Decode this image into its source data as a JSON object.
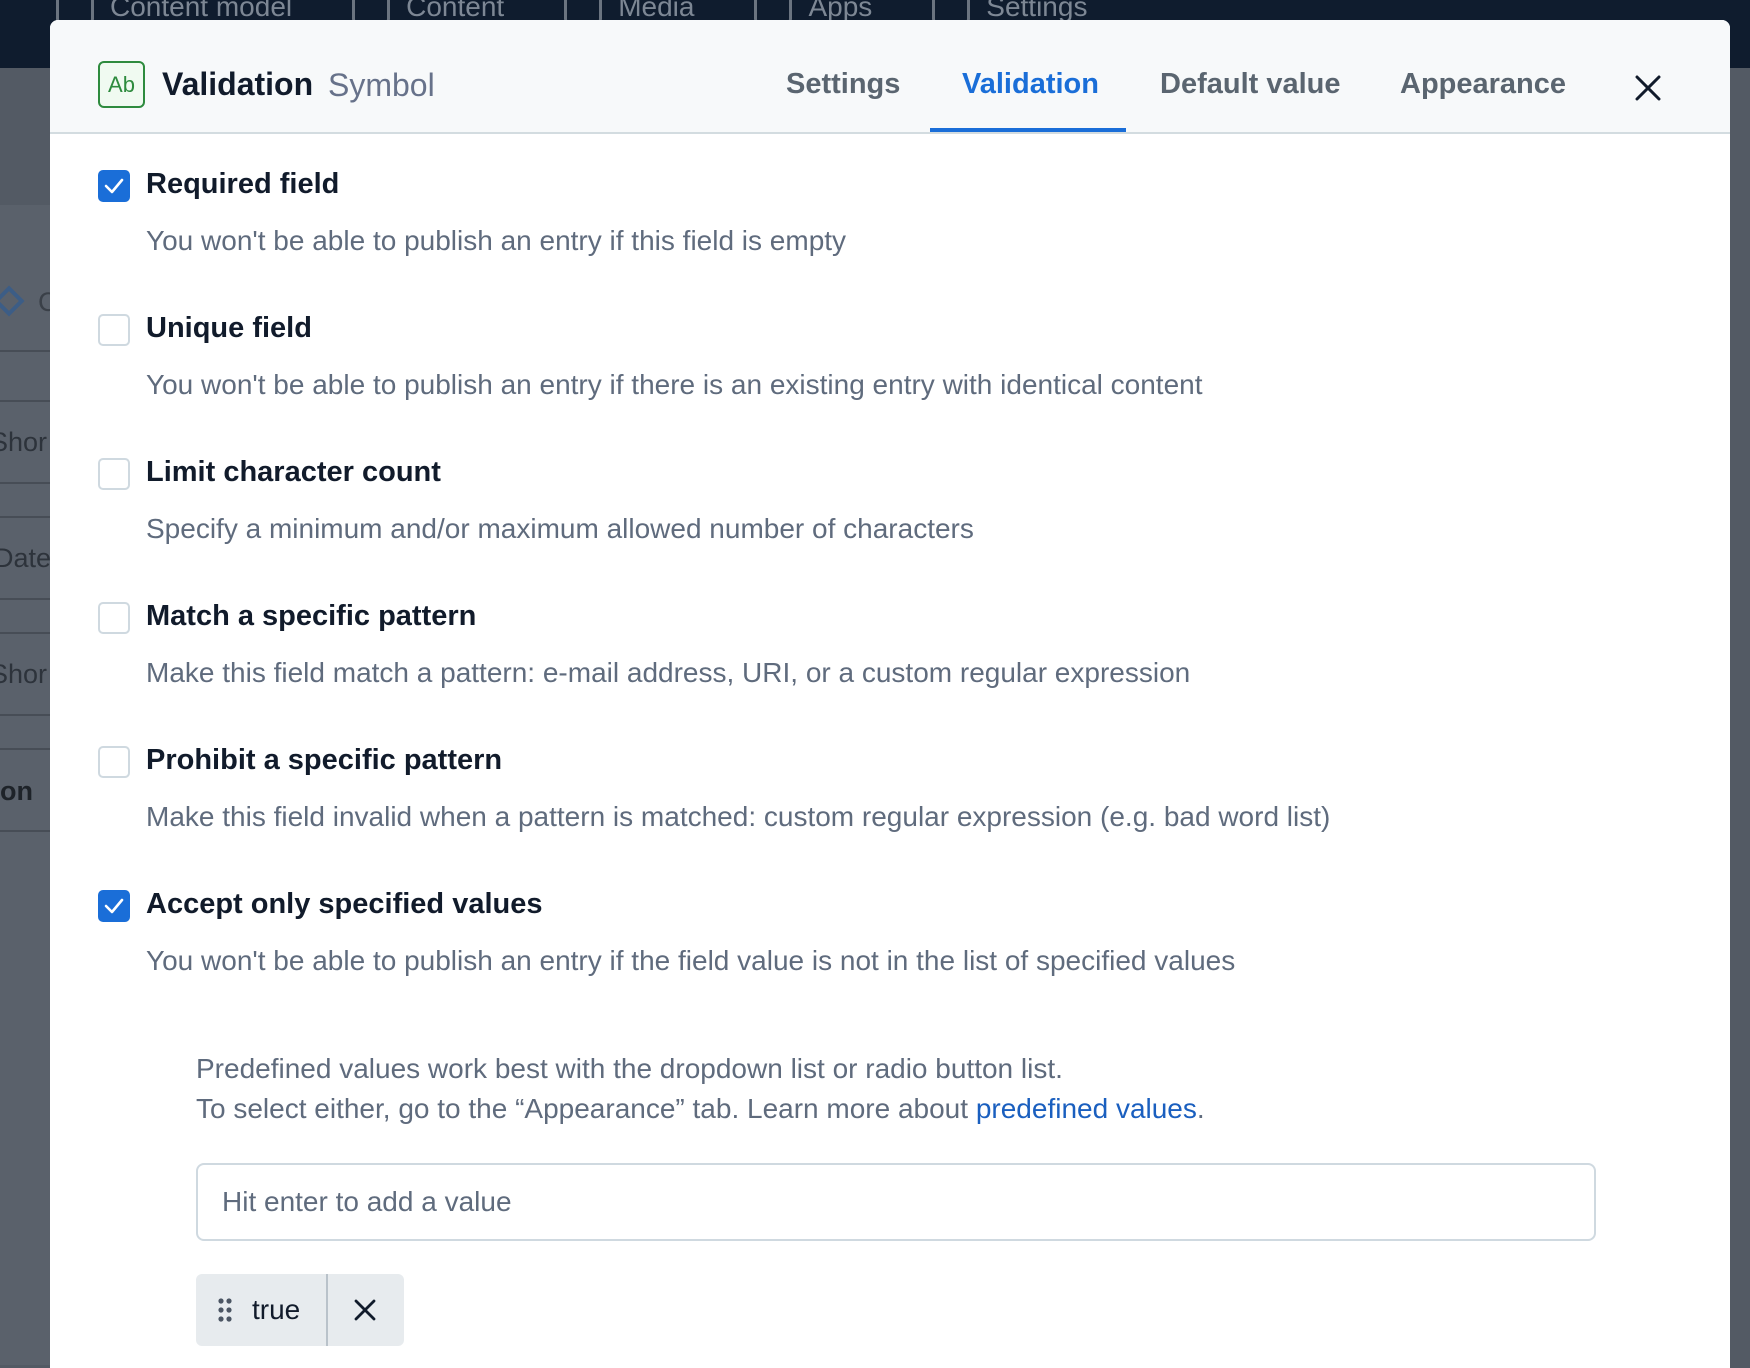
{
  "background": {
    "topnav": [
      "Content model",
      "Content",
      "Media",
      "Apps",
      "Settings"
    ],
    "fragments": [
      "C",
      "Shor",
      "Date",
      "Shor",
      "on"
    ]
  },
  "modal": {
    "type_badge": "Ab",
    "title": "Validation",
    "subtitle": "Symbol",
    "tabs": [
      {
        "label": "Settings",
        "active": false
      },
      {
        "label": "Validation",
        "active": true
      },
      {
        "label": "Default value",
        "active": false
      },
      {
        "label": "Appearance",
        "active": false
      }
    ],
    "close_icon": "close-icon"
  },
  "options": [
    {
      "label": "Required field",
      "description": "You won't be able to publish an entry if this field is empty",
      "checked": true
    },
    {
      "label": "Unique field",
      "description": "You won't be able to publish an entry if there is an existing entry with identical content",
      "checked": false
    },
    {
      "label": "Limit character count",
      "description": "Specify a minimum and/or maximum allowed number of characters",
      "checked": false
    },
    {
      "label": "Match a specific pattern",
      "description": "Make this field match a pattern: e-mail address, URI, or a custom regular expression",
      "checked": false
    },
    {
      "label": "Prohibit a specific pattern",
      "description": "Make this field invalid when a pattern is matched: custom regular expression (e.g. bad word list)",
      "checked": false
    },
    {
      "label": "Accept only specified values",
      "description": "You won't be able to publish an entry if the field value is not in the list of specified values",
      "checked": true
    }
  ],
  "predefined": {
    "help_line1": "Predefined values work best with the dropdown list or radio button list.",
    "help_line2_prefix": "To select either, go to the “Appearance” tab. Learn more about ",
    "help_link": "predefined values",
    "help_line2_suffix": ".",
    "input_value": "",
    "input_placeholder": "Hit enter to add a value",
    "values": [
      "true"
    ]
  },
  "colors": {
    "accent": "#1a6ed8",
    "badge_green": "#2e8b3e",
    "header_bg": "#f7f9fa"
  }
}
